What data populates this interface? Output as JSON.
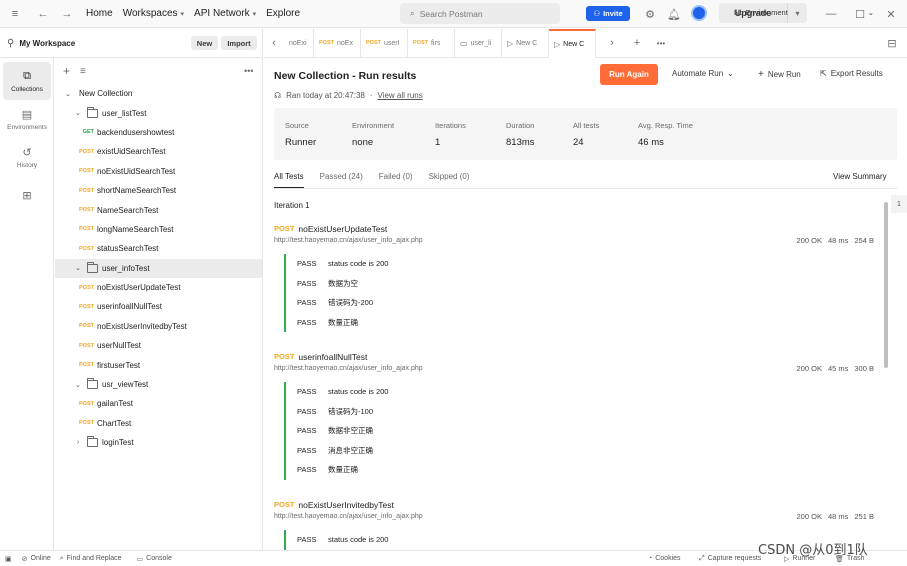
{
  "topbar": {
    "nav": [
      "Home",
      "Workspaces",
      "API Network",
      "Explore"
    ],
    "search_placeholder": "Search Postman",
    "invite_label": "Invite",
    "upgrade_label": "Upgrade"
  },
  "sidebar": {
    "workspace_name": "My Workspace",
    "new_label": "New",
    "import_label": "Import",
    "nav_items": [
      {
        "label": "Collections",
        "icon": "collections-icon"
      },
      {
        "label": "Environments",
        "icon": "environments-icon"
      },
      {
        "label": "History",
        "icon": "history-icon"
      },
      {
        "label": "",
        "icon": "apis-icon"
      }
    ],
    "tree": [
      {
        "type": "collection",
        "label": "New Collection"
      },
      {
        "type": "folder",
        "label": "user_listTest",
        "expanded": true
      },
      {
        "type": "request",
        "method": "GET",
        "label": "backendusershowtest"
      },
      {
        "type": "request",
        "method": "POST",
        "label": "existUidSearchTest"
      },
      {
        "type": "request",
        "method": "POST",
        "label": "noExistUidSearchTest"
      },
      {
        "type": "request",
        "method": "POST",
        "label": "shortNameSearchTest"
      },
      {
        "type": "request",
        "method": "POST",
        "label": "NameSearchTest"
      },
      {
        "type": "request",
        "method": "POST",
        "label": "longNameSearchTest"
      },
      {
        "type": "request",
        "method": "POST",
        "label": "statusSearchTest"
      },
      {
        "type": "folder",
        "label": "user_infoTest",
        "expanded": true,
        "selected": true
      },
      {
        "type": "request",
        "method": "POST",
        "label": "noExistUserUpdateTest"
      },
      {
        "type": "request",
        "method": "POST",
        "label": "userinfoallNullTest"
      },
      {
        "type": "request",
        "method": "POST",
        "label": "noExistUserInvitedbyTest"
      },
      {
        "type": "request",
        "method": "POST",
        "label": "userNullTest"
      },
      {
        "type": "request",
        "method": "POST",
        "label": "firstuserTest"
      },
      {
        "type": "folder",
        "label": "usr_viewTest",
        "expanded": true
      },
      {
        "type": "request",
        "method": "POST",
        "label": "gailanTest"
      },
      {
        "type": "request",
        "method": "POST",
        "label": "ChartTest"
      },
      {
        "type": "folder",
        "label": "loginTest",
        "expanded": false
      }
    ]
  },
  "tabs": [
    {
      "method": "",
      "label": "noExi"
    },
    {
      "method": "POST",
      "label": "noEx"
    },
    {
      "method": "POST",
      "label": "userI"
    },
    {
      "method": "POST",
      "label": "firs"
    },
    {
      "method": "",
      "label": "user_li"
    },
    {
      "method": "",
      "label": "New C"
    },
    {
      "method": "",
      "label": "New C",
      "active": true
    }
  ],
  "environment": "No Environment",
  "run": {
    "title": "New Collection - Run results",
    "run_again": "Run Again",
    "automate": "Automate Run",
    "new_run": "New Run",
    "export": "Export Results",
    "meta": "Ran today at 20:47:38",
    "view_all": "View all runs",
    "summary": [
      {
        "label": "Source",
        "value": "Runner"
      },
      {
        "label": "Environment",
        "value": "none"
      },
      {
        "label": "Iterations",
        "value": "1"
      },
      {
        "label": "Duration",
        "value": "813ms"
      },
      {
        "label": "All tests",
        "value": "24"
      },
      {
        "label": "Avg. Resp. Time",
        "value": "46 ms"
      }
    ],
    "subtabs": [
      "All Tests",
      "Passed (24)",
      "Failed (0)",
      "Skipped (0)"
    ],
    "view_summary": "View Summary",
    "iteration": "Iteration 1",
    "requests": [
      {
        "method": "POST",
        "name": "noExistUserUpdateTest",
        "url": "http://test.haoyemao.cn/ajax/user_info_ajax.php",
        "status": "200 OK",
        "time": "48 ms",
        "size": "254 B",
        "results": [
          {
            "state": "PASS",
            "name": "status code is 200"
          },
          {
            "state": "PASS",
            "name": "数据为空"
          },
          {
            "state": "PASS",
            "name": "错误码为-200"
          },
          {
            "state": "PASS",
            "name": "数量正确"
          }
        ]
      },
      {
        "method": "POST",
        "name": "userinfoallNullTest",
        "url": "http://test.haoyemao.cn/ajax/user_info_ajax.php",
        "status": "200 OK",
        "time": "45 ms",
        "size": "300 B",
        "results": [
          {
            "state": "PASS",
            "name": "status code is 200"
          },
          {
            "state": "PASS",
            "name": "错误码为-100"
          },
          {
            "state": "PASS",
            "name": "数据非空正确"
          },
          {
            "state": "PASS",
            "name": "消息非空正确"
          },
          {
            "state": "PASS",
            "name": "数量正确"
          }
        ]
      },
      {
        "method": "POST",
        "name": "noExistUserInvitedbyTest",
        "url": "http://test.haoyemao.cn/ajax/user_info_ajax.php",
        "status": "200 OK",
        "time": "48 ms",
        "size": "251 B",
        "results": [
          {
            "state": "PASS",
            "name": "status code is 200"
          }
        ]
      }
    ]
  },
  "right_badge": "1",
  "statusbar": {
    "online": "Online",
    "find_replace": "Find and Replace",
    "console": "Console",
    "cookies": "Cookies",
    "capture": "Capture requests",
    "runner": "Runner",
    "trash": "Trash"
  },
  "watermark": "CSDN @从0到1队"
}
